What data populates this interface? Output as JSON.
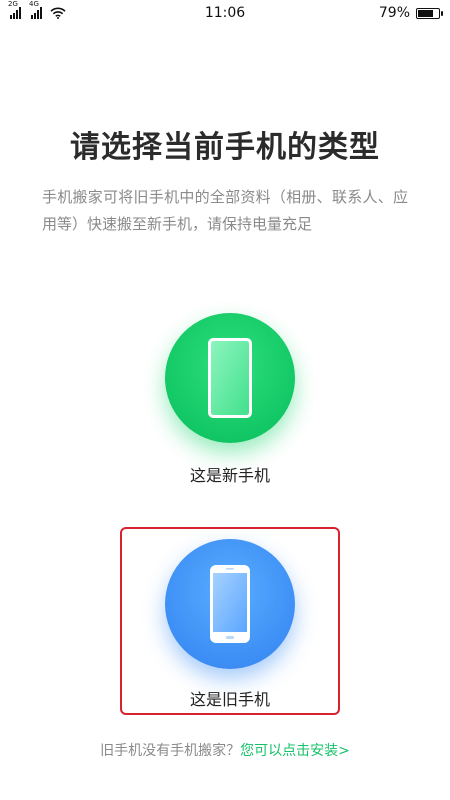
{
  "status_bar": {
    "network_1": "2G",
    "network_2": "4G",
    "time": "11:06",
    "battery_text": "79%",
    "battery_level": 0.79,
    "icons": [
      "signal-icon",
      "signal-icon",
      "wifi-icon",
      "battery-icon"
    ]
  },
  "main": {
    "title": "请选择当前手机的类型",
    "description": "手机搬家可将旧手机中的全部资料（相册、联系人、应用等）快速搬至新手机，请保持电量充足"
  },
  "options": {
    "new_phone": {
      "label": "这是新手机",
      "color": "#12c765",
      "icon": "phone-icon"
    },
    "old_phone": {
      "label": "这是旧手机",
      "color": "#3d8ef5",
      "icon": "phone-icon",
      "selected": true
    }
  },
  "footer": {
    "prompt": "旧手机没有手机搬家？",
    "link": "您可以点击安装>",
    "link_color": "#17c06a"
  }
}
